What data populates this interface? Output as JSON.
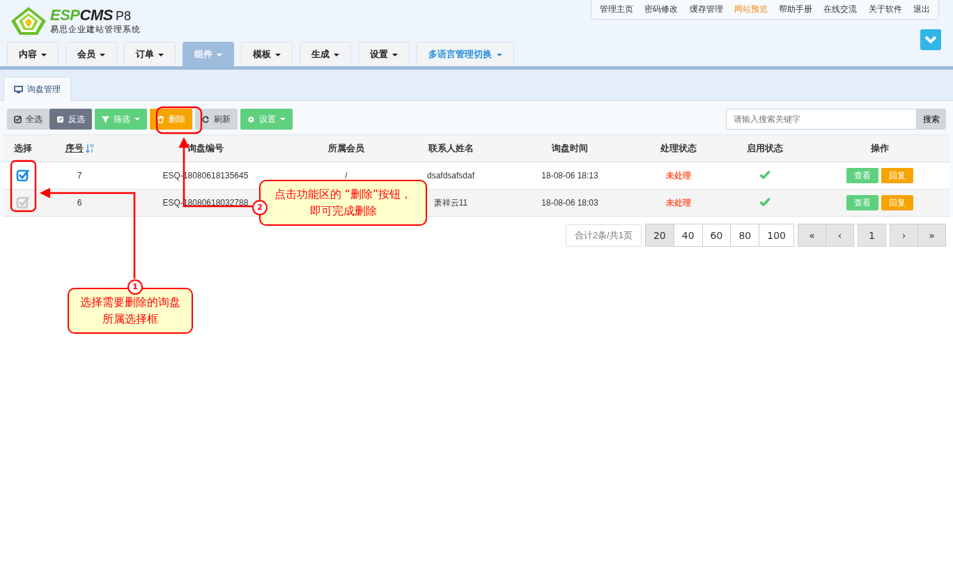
{
  "logo": {
    "brand": [
      "ESP",
      "CMS"
    ],
    "version": "P8",
    "subtitle": "易思企业建站管理系统"
  },
  "top_links": [
    {
      "label": "管理主页",
      "selected": false
    },
    {
      "label": "密码修改",
      "selected": false
    },
    {
      "label": "缓存管理",
      "selected": false
    },
    {
      "label": "网站预览",
      "selected": true
    },
    {
      "label": "帮助手册",
      "selected": false
    },
    {
      "label": "在线交流",
      "selected": false
    },
    {
      "label": "关于软件",
      "selected": false
    },
    {
      "label": "退出",
      "selected": false
    }
  ],
  "nav_tabs": [
    {
      "label": "内容",
      "selected": false,
      "kind": "menu"
    },
    {
      "label": "会员",
      "selected": false,
      "kind": "menu"
    },
    {
      "label": "订单",
      "selected": false,
      "kind": "menu"
    },
    {
      "label": "组件",
      "selected": true,
      "kind": "menu"
    },
    {
      "label": "模板",
      "selected": false,
      "kind": "menu"
    },
    {
      "label": "生成",
      "selected": false,
      "kind": "menu"
    },
    {
      "label": "设置",
      "selected": false,
      "kind": "menu"
    },
    {
      "label": "多语言管理切换",
      "selected": false,
      "kind": "language"
    }
  ],
  "page_tabs": [
    {
      "label": "询盘管理",
      "selected": true
    }
  ],
  "toolbar": [
    {
      "label": "全选",
      "kind": "select_all",
      "dropdown": false
    },
    {
      "label": "反选",
      "kind": "invert",
      "dropdown": false
    },
    {
      "label": "筛选",
      "kind": "filter",
      "dropdown": true
    },
    {
      "label": "删除",
      "kind": "delete",
      "dropdown": false
    },
    {
      "label": "刷新",
      "kind": "refresh",
      "dropdown": false
    },
    {
      "label": "设置",
      "kind": "settings",
      "dropdown": true
    }
  ],
  "search": {
    "placeholder": "请输入搜索关键字",
    "button": "搜索"
  },
  "table": {
    "columns": [
      {
        "label": "选择",
        "sortable": false
      },
      {
        "label": "序号",
        "sortable": true
      },
      {
        "label": "询盘编号",
        "sortable": false
      },
      {
        "label": "所属会员",
        "sortable": false
      },
      {
        "label": "联系人姓名",
        "sortable": false
      },
      {
        "label": "询盘时间",
        "sortable": false
      },
      {
        "label": "处理状态",
        "sortable": false
      },
      {
        "label": "启用状态",
        "sortable": false
      },
      {
        "label": "操作",
        "sortable": false
      }
    ],
    "rows": [
      {
        "checked": true,
        "index": "7",
        "code": "ESQ-18080618135645",
        "member": "/",
        "contact": "dsafdsafsdaf",
        "time": "18-08-06 18:13",
        "status": "未处理",
        "enabled": true,
        "actions": [
          "查看",
          "回复"
        ]
      },
      {
        "checked": false,
        "index": "6",
        "code": "ESQ-18080618032788",
        "contact": "萧祥云11",
        "time": "18-08-06 18:03",
        "status": "未处理",
        "enabled": true,
        "actions": [
          "查看",
          "回复"
        ]
      }
    ]
  },
  "pagination": {
    "summary": "合计2条/共1页",
    "sizes": [
      {
        "label": "20",
        "selected": true
      },
      {
        "label": "40",
        "selected": false
      },
      {
        "label": "60",
        "selected": false
      },
      {
        "label": "80",
        "selected": false
      },
      {
        "label": "100",
        "selected": false
      }
    ],
    "nav": [
      "«",
      "‹",
      "1",
      "›",
      "»"
    ]
  },
  "annotations": [
    {
      "number": "1",
      "text": "选择需要删除的询盘所属选择框"
    },
    {
      "number": "2",
      "text": "点击功能区的 “删除”按钮，即可完成删除"
    }
  ]
}
